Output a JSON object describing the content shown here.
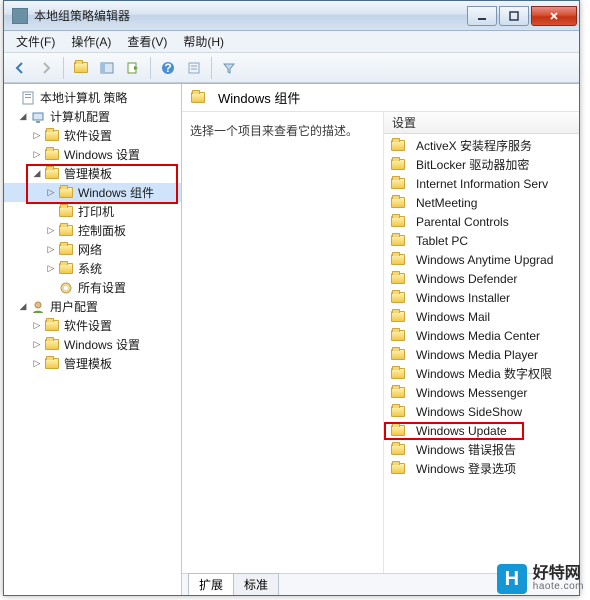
{
  "window": {
    "title": "本地组策略编辑器"
  },
  "menu": {
    "file": "文件(F)",
    "action": "操作(A)",
    "view": "查看(V)",
    "help": "帮助(H)"
  },
  "tree": {
    "root": "本地计算机 策略",
    "computer_config": "计算机配置",
    "software_settings": "软件设置",
    "windows_settings": "Windows 设置",
    "admin_templates": "管理模板",
    "windows_components": "Windows 组件",
    "printers": "打印机",
    "control_panel": "控制面板",
    "network": "网络",
    "system": "系统",
    "all_settings": "所有设置",
    "user_config": "用户配置",
    "software_settings2": "软件设置",
    "windows_settings2": "Windows 设置",
    "admin_templates2": "管理模板"
  },
  "pathbar": {
    "title": "Windows 组件"
  },
  "desc": {
    "text": "选择一个项目来查看它的描述。"
  },
  "listheader": {
    "settings": "设置"
  },
  "items": [
    "ActiveX 安装程序服务",
    "BitLocker 驱动器加密",
    "Internet Information Serv",
    "NetMeeting",
    "Parental Controls",
    "Tablet PC",
    "Windows Anytime Upgrad",
    "Windows Defender",
    "Windows Installer",
    "Windows Mail",
    "Windows Media Center",
    "Windows Media Player",
    "Windows Media 数字权限",
    "Windows Messenger",
    "Windows SideShow",
    "Windows Update",
    "Windows 错误报告",
    "Windows 登录选项"
  ],
  "tabs": {
    "extended": "扩展",
    "standard": "标准"
  },
  "watermark": {
    "logo": "H",
    "cn": "好特网",
    "en": "haote.com"
  }
}
